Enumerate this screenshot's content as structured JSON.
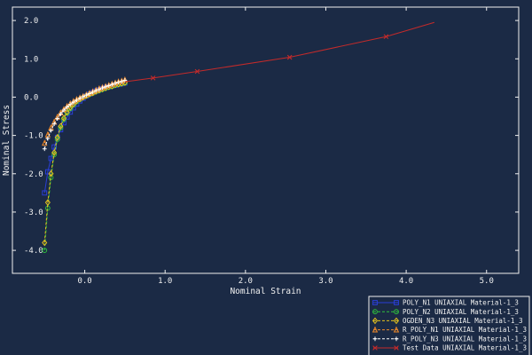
{
  "chart_data": {
    "type": "line",
    "title": "",
    "xlabel": "Nominal Strain",
    "ylabel": "Nominal Stress",
    "xlim": [
      -0.9,
      5.4
    ],
    "ylim": [
      -4.6,
      2.35
    ],
    "xticks": [
      0.0,
      1.0,
      2.0,
      3.0,
      4.0,
      5.0
    ],
    "yticks": [
      -4.0,
      -3.0,
      -2.0,
      -1.0,
      0.0,
      1.0,
      2.0
    ],
    "xtick_labels": [
      "0.0",
      "1.0",
      "2.0",
      "3.0",
      "4.0",
      "5.0"
    ],
    "ytick_labels": [
      "-4.0",
      "-3.0",
      "-2.0",
      "-1.0",
      "0.0",
      "1.0",
      "2.0"
    ],
    "grid": false,
    "legend_position": "bottom-right",
    "colors": {
      "background": "#1b2a45",
      "axes": "#f0f0f0"
    },
    "series": [
      {
        "name": "POLY_N1 UNIAXIAL Material-1_3",
        "color": "#2a3fd6",
        "line_style": "solid",
        "marker": "square",
        "x": [
          -0.5,
          -0.46,
          -0.42,
          -0.38,
          -0.34,
          -0.3,
          -0.26,
          -0.22,
          -0.18,
          -0.14,
          -0.1,
          -0.06,
          -0.02,
          0.02,
          0.06,
          0.1,
          0.14,
          0.18,
          0.22,
          0.26,
          0.3,
          0.34,
          0.38,
          0.42,
          0.46,
          0.5
        ],
        "y": [
          -2.5,
          -1.95,
          -1.6,
          -1.3,
          -1.05,
          -0.85,
          -0.67,
          -0.52,
          -0.39,
          -0.28,
          -0.18,
          -0.1,
          -0.03,
          0.03,
          0.08,
          0.12,
          0.16,
          0.19,
          0.22,
          0.25,
          0.27,
          0.29,
          0.31,
          0.33,
          0.35,
          0.37
        ]
      },
      {
        "name": "POLY_N2 UNIAXIAL Material-1_3",
        "color": "#2fbf3c",
        "line_style": "dashed",
        "marker": "circle",
        "x": [
          -0.5,
          -0.46,
          -0.42,
          -0.38,
          -0.34,
          -0.3,
          -0.26,
          -0.22,
          -0.18,
          -0.14,
          -0.1,
          -0.06,
          -0.02,
          0.02,
          0.06,
          0.1,
          0.14,
          0.18,
          0.22,
          0.26,
          0.3,
          0.34,
          0.38,
          0.42,
          0.46,
          0.5
        ],
        "y": [
          -4.0,
          -2.9,
          -2.1,
          -1.5,
          -1.1,
          -0.8,
          -0.58,
          -0.42,
          -0.3,
          -0.2,
          -0.12,
          -0.06,
          -0.01,
          0.03,
          0.07,
          0.1,
          0.14,
          0.17,
          0.2,
          0.23,
          0.26,
          0.28,
          0.31,
          0.33,
          0.35,
          0.37
        ]
      },
      {
        "name": "OGDEN_N3 UNIAXIAL Material-1_3",
        "color": "#e6c21e",
        "line_style": "dashed",
        "marker": "diamond",
        "x": [
          -0.5,
          -0.46,
          -0.42,
          -0.38,
          -0.34,
          -0.3,
          -0.26,
          -0.22,
          -0.18,
          -0.14,
          -0.1,
          -0.06,
          -0.02,
          0.02,
          0.06,
          0.1,
          0.14,
          0.18,
          0.22,
          0.26,
          0.3,
          0.34,
          0.38,
          0.42,
          0.46,
          0.5
        ],
        "y": [
          -3.8,
          -2.75,
          -2.0,
          -1.45,
          -1.05,
          -0.76,
          -0.55,
          -0.39,
          -0.27,
          -0.18,
          -0.1,
          -0.05,
          0.0,
          0.04,
          0.08,
          0.11,
          0.15,
          0.18,
          0.21,
          0.24,
          0.27,
          0.29,
          0.32,
          0.34,
          0.36,
          0.38
        ]
      },
      {
        "name": "R_POLY_N1 UNIAXIAL Material-1_3",
        "color": "#f08a2a",
        "line_style": "dashed",
        "marker": "triangle",
        "x": [
          -0.5,
          -0.46,
          -0.42,
          -0.38,
          -0.34,
          -0.3,
          -0.26,
          -0.22,
          -0.18,
          -0.14,
          -0.1,
          -0.06,
          -0.02,
          0.02,
          0.06,
          0.1,
          0.14,
          0.18,
          0.22,
          0.26,
          0.3,
          0.34,
          0.38,
          0.42,
          0.46,
          0.5
        ],
        "y": [
          -1.2,
          -0.98,
          -0.8,
          -0.65,
          -0.52,
          -0.41,
          -0.32,
          -0.24,
          -0.17,
          -0.11,
          -0.06,
          -0.02,
          0.02,
          0.06,
          0.1,
          0.14,
          0.18,
          0.22,
          0.25,
          0.28,
          0.31,
          0.34,
          0.37,
          0.4,
          0.42,
          0.45
        ]
      },
      {
        "name": "R_POLY_N3 UNIAXIAL Material-1_3",
        "color": "#ffffff",
        "line_style": "dashed",
        "marker": "plus",
        "x": [
          -0.5,
          -0.46,
          -0.42,
          -0.38,
          -0.34,
          -0.3,
          -0.26,
          -0.22,
          -0.18,
          -0.14,
          -0.1,
          -0.06,
          -0.02,
          0.02,
          0.06,
          0.1,
          0.14,
          0.18,
          0.22,
          0.26,
          0.3,
          0.34,
          0.38,
          0.42,
          0.46,
          0.5
        ],
        "y": [
          -1.35,
          -1.08,
          -0.87,
          -0.7,
          -0.56,
          -0.44,
          -0.34,
          -0.26,
          -0.19,
          -0.13,
          -0.08,
          -0.03,
          0.01,
          0.05,
          0.09,
          0.13,
          0.17,
          0.2,
          0.24,
          0.27,
          0.3,
          0.33,
          0.36,
          0.39,
          0.41,
          0.44
        ]
      },
      {
        "name": "Test Data UNIAXIAL Material-1_3",
        "color": "#c42a2a",
        "line_style": "solid",
        "marker": "x",
        "x": [
          0.5,
          0.85,
          1.4,
          2.55,
          3.75,
          4.35
        ],
        "y": [
          0.4,
          0.5,
          0.67,
          1.04,
          1.58,
          1.95
        ],
        "marker_x": [
          0.85,
          1.4,
          2.55,
          3.75
        ],
        "marker_y": [
          0.5,
          0.67,
          1.04,
          1.58
        ]
      }
    ]
  }
}
